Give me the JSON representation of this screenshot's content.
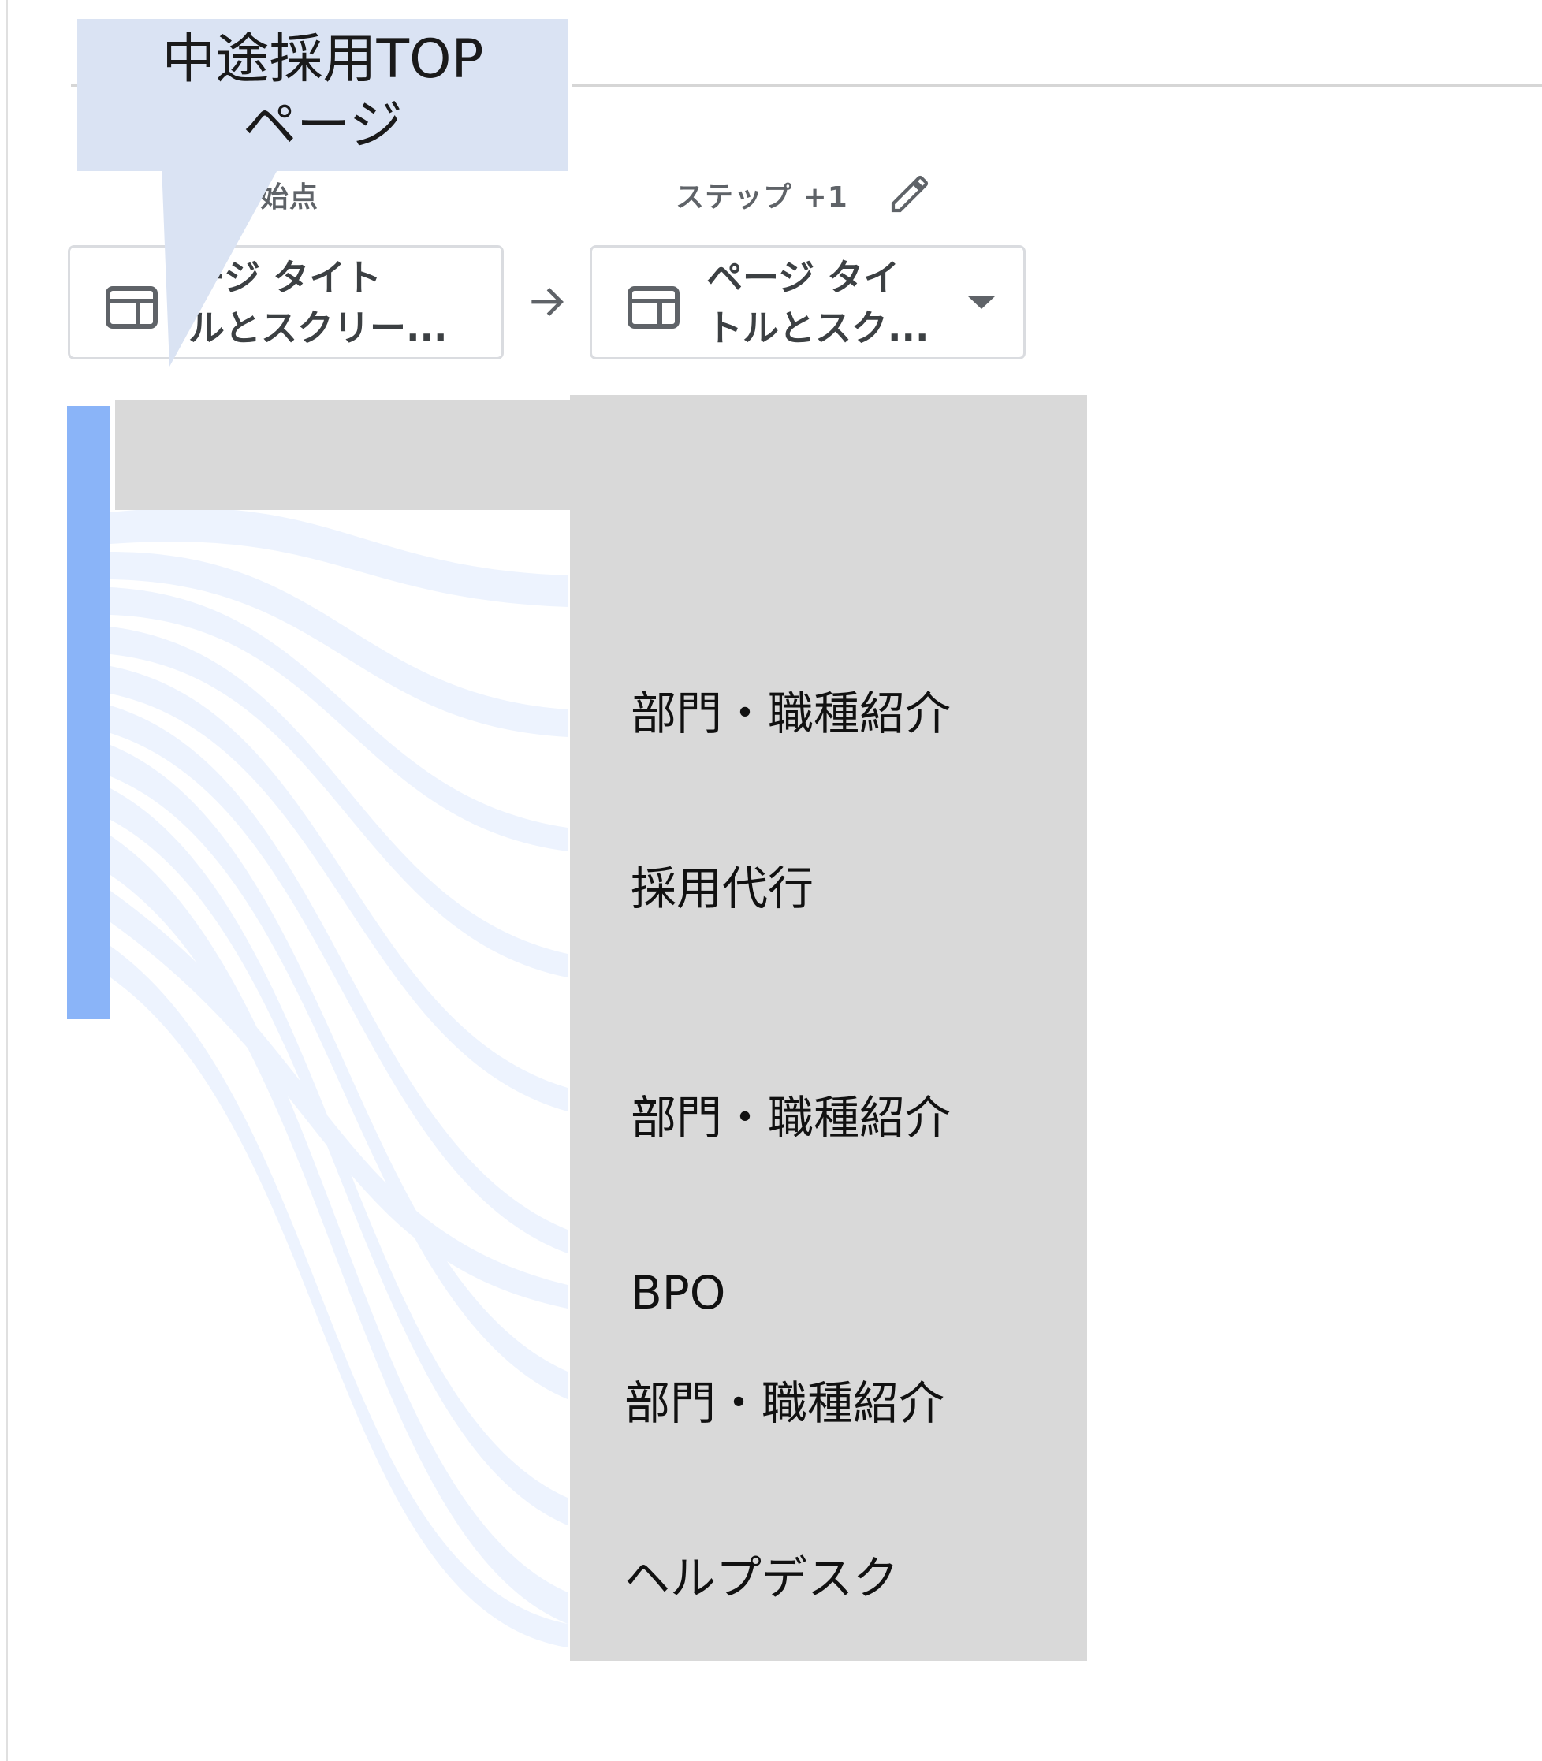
{
  "callout": {
    "line1": "中途採用TOP",
    "line2": "ページ"
  },
  "steps": {
    "start_label": "始点",
    "next_label": "ステップ +1"
  },
  "dimensions": {
    "start_line1": "ージ タイト",
    "start_line2": "ルとスクリー...",
    "next_line1": "ページ タイ",
    "next_line2": "トルとスク..."
  },
  "nodes": [
    {
      "line1": "部門・職種紹介",
      "line2": "採用代行"
    },
    {
      "line1": "部門・職種紹介",
      "line2": "BPO"
    },
    {
      "line1": "部門・職種紹介",
      "line2": "ヘルプデスク"
    }
  ],
  "icons": {
    "dimension": "table-icon",
    "arrow": "arrow-right-icon",
    "edit": "pencil-icon",
    "dropdown": "caret-down-icon"
  },
  "colors": {
    "node_bar": "#8ab4f8",
    "flow": "#e8f0fe",
    "overlay": "#d9d9d9",
    "callout": "#dae3f3"
  }
}
